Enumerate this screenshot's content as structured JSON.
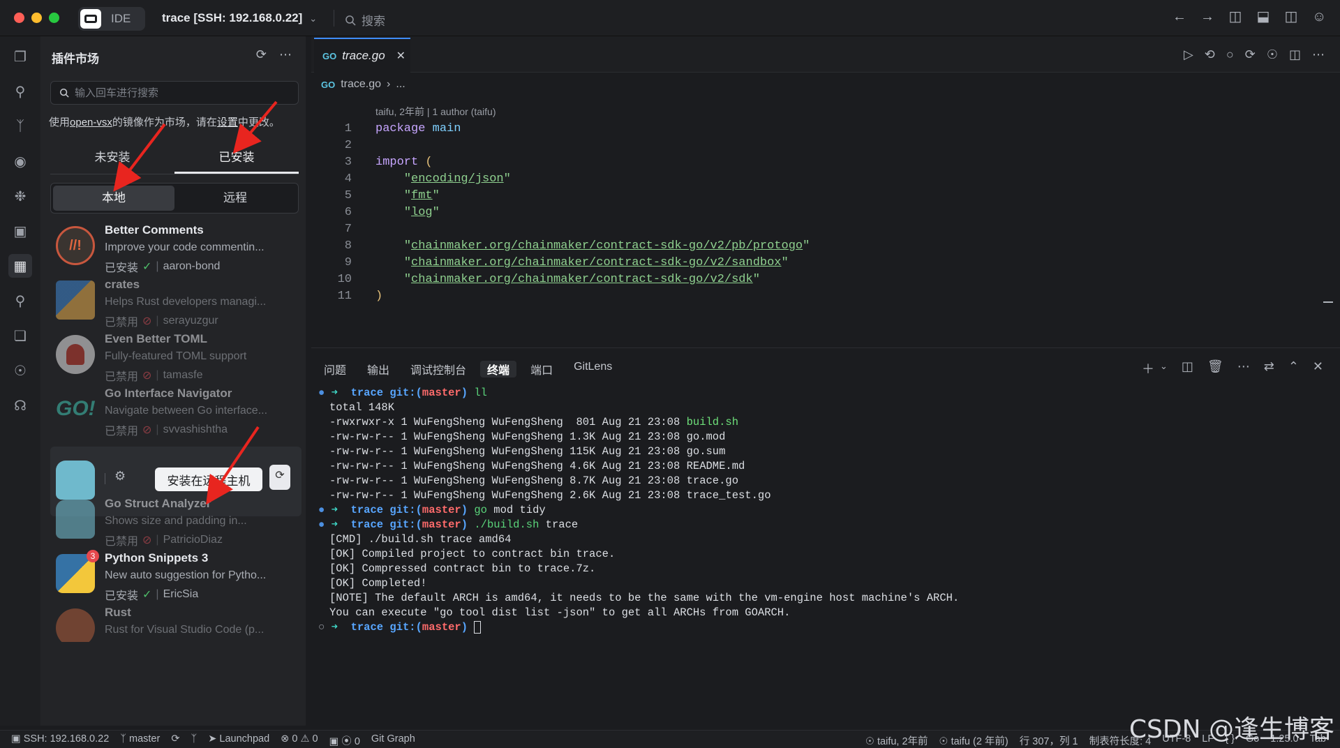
{
  "titlebar": {
    "ide_label": "IDE",
    "window_title": "trace [SSH: 192.168.0.22]",
    "search_label": "搜索"
  },
  "sidebar": {
    "title": "插件市场",
    "search_placeholder": "输入回车进行搜索",
    "notice_pre": "使用",
    "notice_link1": "open-vsx",
    "notice_mid": "的镜像作为市场，请在",
    "notice_link2": "设置",
    "notice_post": "中更改。",
    "tabs": [
      "未安装",
      "已安装"
    ],
    "segments": [
      "本地",
      "远程"
    ],
    "extensions": [
      {
        "name": "Better Comments",
        "desc": "Improve your code commentin...",
        "status": "已安装",
        "author": "aaron-bond"
      },
      {
        "name": "crates",
        "desc": "Helps Rust developers managi...",
        "status": "已禁用",
        "author": "serayuzgur"
      },
      {
        "name": "Even Better TOML",
        "desc": "Fully-featured TOML support",
        "status": "已禁用",
        "author": "tamasfe"
      },
      {
        "name": "Go Interface Navigator",
        "desc": "Navigate between Go interface...",
        "status": "已禁用",
        "author": "svvashishtha"
      },
      {
        "name": "Go Struct Analyzer",
        "desc": "Shows size and padding in...",
        "status": "已禁用",
        "author": "PatricioDiaz"
      },
      {
        "name": "Python Snippets 3",
        "desc": "New auto suggestion for Pytho...",
        "status": "已安装",
        "author": "EricSia"
      },
      {
        "name": "Rust",
        "desc": "Rust for Visual Studio Code (p...",
        "status": "",
        "author": ""
      }
    ],
    "install_remote_label": "安装在远程主机",
    "python_badge": "3"
  },
  "editor": {
    "tab_label": "trace.go",
    "breadcrumb_file": "trace.go",
    "breadcrumb_more": "...",
    "blame": "taifu, 2年前 | 1 author (taifu)",
    "line_numbers": [
      "1",
      "2",
      "3",
      "4",
      "5",
      "6",
      "7",
      "8",
      "9",
      "10",
      "11"
    ],
    "code": {
      "kw_package": "package",
      "pkg_name": "main",
      "kw_import": "import",
      "paren_open": "(",
      "paren_close": ")",
      "imp_json": "encoding/json",
      "imp_fmt": "fmt",
      "imp_log": "log",
      "imp_protogo": "chainmaker.org/chainmaker/contract-sdk-go/v2/pb/protogo",
      "imp_sandbox": "chainmaker.org/chainmaker/contract-sdk-go/v2/sandbox",
      "imp_sdk": "chainmaker.org/chainmaker/contract-sdk-go/v2/sdk"
    }
  },
  "panel": {
    "tabs": [
      "问题",
      "输出",
      "调试控制台",
      "终端",
      "端口",
      "GitLens"
    ],
    "terminal": {
      "dir": "trace",
      "git": "git:(",
      "branch": "master",
      "git_close": ")",
      "cmd1": "ll",
      "total": "total 148K",
      "files": [
        {
          "prefix": "-rwxrwxr-x 1 WuFengSheng WuFengSheng  801 Aug 21 23:08 ",
          "name": "build.sh",
          "exec": true
        },
        {
          "prefix": "-rw-rw-r-- 1 WuFengSheng WuFengSheng 1.3K Aug 21 23:08 ",
          "name": "go.mod",
          "exec": false
        },
        {
          "prefix": "-rw-rw-r-- 1 WuFengSheng WuFengSheng 115K Aug 21 23:08 ",
          "name": "go.sum",
          "exec": false
        },
        {
          "prefix": "-rw-rw-r-- 1 WuFengSheng WuFengSheng 4.6K Aug 21 23:08 ",
          "name": "README.md",
          "exec": false
        },
        {
          "prefix": "-rw-rw-r-- 1 WuFengSheng WuFengSheng 8.7K Aug 21 23:08 ",
          "name": "trace.go",
          "exec": false
        },
        {
          "prefix": "-rw-rw-r-- 1 WuFengSheng WuFengSheng 2.6K Aug 21 23:08 ",
          "name": "trace_test.go",
          "exec": false
        }
      ],
      "cmd2_a": "go",
      "cmd2_b": " mod tidy",
      "cmd3_a": "./build.sh",
      "cmd3_b": " trace",
      "out": [
        "[CMD] ./build.sh trace amd64",
        "[OK] Compiled project to contract bin trace.",
        "[OK] Compressed contract bin to trace.7z.",
        "[OK] Completed!",
        "[NOTE] The default ARCH is amd64, it needs to be the same with the vm-engine host machine's ARCH.",
        "You can execute \"go tool dist list -json\" to get all ARCHs from GOARCH."
      ]
    }
  },
  "statusbar": {
    "ssh": "SSH: 192.168.0.22",
    "branch": "master",
    "launchpad": "Launchpad",
    "errors": "0",
    "warnings": "0",
    "ports": "0",
    "git_graph": "Git Graph",
    "blame1": "taifu, 2年前",
    "blame2": "taifu (2 年前)",
    "position": "行 307，列 1",
    "tab_size": "制表符长度: 4",
    "encoding": "UTF-8",
    "eol": "LF",
    "braces": "{ }",
    "lang": "Go",
    "version": "1.25.0",
    "tab": "Tab"
  },
  "watermark": "CSDN @逢生博客"
}
